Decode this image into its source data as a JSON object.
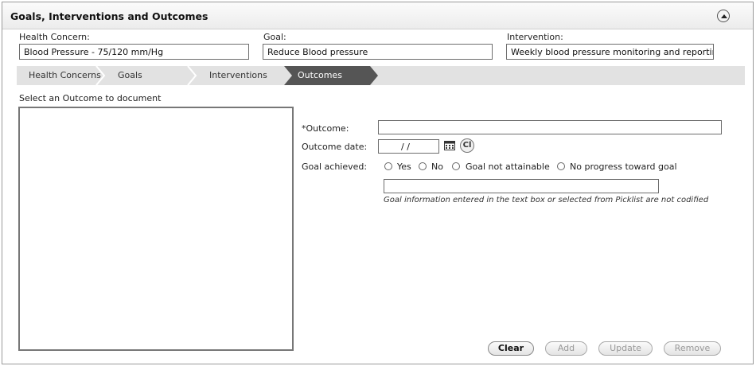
{
  "panel": {
    "title": "Goals, Interventions and Outcomes",
    "collapse_icon": "chevron-up-circle-icon"
  },
  "summary": {
    "health_concern_label": "Health Concern:",
    "health_concern_value": "Blood Pressure - 75/120 mm/Hg",
    "goal_label": "Goal:",
    "goal_value": "Reduce Blood pressure",
    "intervention_label": "Intervention:",
    "intervention_value": "Weekly blood pressure monitoring and reporting."
  },
  "tabs": [
    {
      "label": "Health Concerns",
      "active": false
    },
    {
      "label": "Goals",
      "active": false
    },
    {
      "label": "Interventions",
      "active": false
    },
    {
      "label": "Outcomes",
      "active": true
    }
  ],
  "outcome_list": {
    "caption": "Select an Outcome to document",
    "items": []
  },
  "form": {
    "outcome_label": "*Outcome:",
    "outcome_value": "",
    "date_label": "Outcome date:",
    "date_value": "/ /",
    "calendar_icon": "calendar-icon",
    "cl_button_label": "Cl",
    "goal_achieved_label": "Goal achieved:",
    "goal_options": [
      "Yes",
      "No",
      "Goal not attainable",
      "No progress toward goal"
    ],
    "goal_selected": null,
    "goal_info_value": "",
    "hint": "Goal information entered in the text box or selected from Picklist are not codified"
  },
  "buttons": {
    "clear": "Clear",
    "add": "Add",
    "update": "Update",
    "remove": "Remove"
  },
  "colors": {
    "active_tab": "#555555",
    "tab_bar": "#e2e2e2"
  }
}
